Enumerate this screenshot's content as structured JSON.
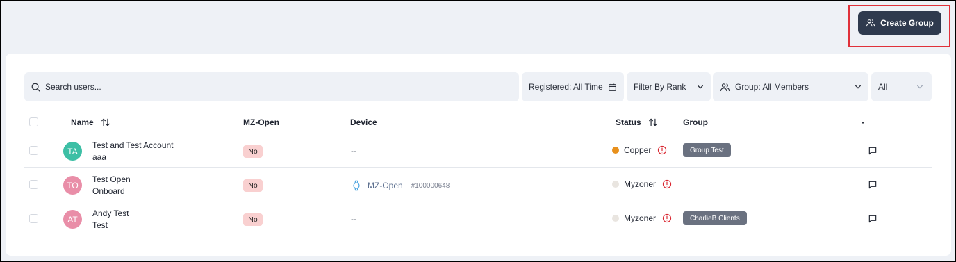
{
  "header": {
    "create_group_label": "Create Group"
  },
  "filters": {
    "search_placeholder": "Search users...",
    "registered_label": "Registered: All Time",
    "rank_label": "Filter By Rank",
    "group_label": "Group: All Members",
    "all_label": "All"
  },
  "table": {
    "columns": {
      "name": "Name",
      "mz_open": "MZ-Open",
      "device": "Device",
      "status": "Status",
      "group": "Group",
      "actions": "-"
    },
    "rows": [
      {
        "initials": "TA",
        "avatar_color": "#3dbfa5",
        "name_line1": "Test and Test Account",
        "name_line2": "aaa",
        "mz_open": "No",
        "device": "--",
        "status": "Copper",
        "status_color": "#e8901c",
        "group": "Group Test"
      },
      {
        "initials": "TO",
        "avatar_color": "#e98ea8",
        "name_line1": "Test Open",
        "name_line2": "Onboard",
        "mz_open": "No",
        "device_name": "MZ-Open",
        "device_id": "#100000648",
        "status": "Myzoner",
        "status_color": "#e9e5e0",
        "group": ""
      },
      {
        "initials": "AT",
        "avatar_color": "#e98ea8",
        "name_line1": "Andy Test",
        "name_line2": "Test",
        "mz_open": "No",
        "device": "--",
        "status": "Myzoner",
        "status_color": "#e9e5e0",
        "group": "CharlieB Clients"
      }
    ]
  },
  "colors": {
    "primary_button": "#2f3a4e",
    "highlight_border": "#e0313a",
    "no_pill": "#f9d0d0",
    "group_tag": "#6a7180",
    "warning": "#d9252f"
  },
  "icons": [
    "users-icon",
    "search-icon",
    "calendar-icon",
    "chevron-down-icon",
    "sort-icon",
    "watch-icon",
    "alert-circle-icon",
    "message-icon"
  ]
}
